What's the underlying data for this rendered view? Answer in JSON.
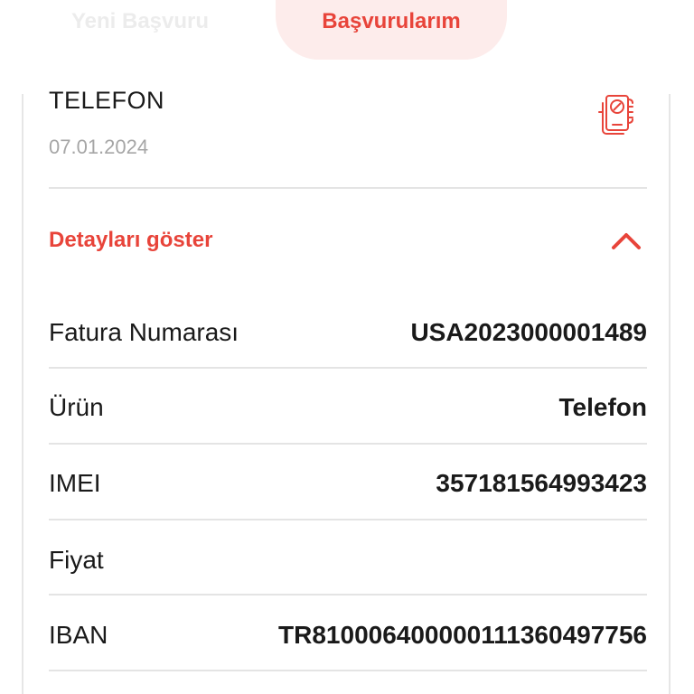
{
  "tabs": {
    "new_label": "Yeni Başvuru",
    "mine_label": "Başvurularım"
  },
  "application": {
    "title": "TELEFON",
    "date": "07.01.2024",
    "icon": "phone-check-icon"
  },
  "details": {
    "toggle_label": "Detayları göster",
    "rows": [
      {
        "label": "Fatura Numarası",
        "value": "USA2023000001489"
      },
      {
        "label": "Ürün",
        "value": "Telefon"
      },
      {
        "label": "IMEI",
        "value": "357181564993423"
      },
      {
        "label": "Fiyat",
        "value": ""
      },
      {
        "label": "IBAN",
        "value": "TR810006400000111360497756"
      }
    ]
  },
  "colors": {
    "accent": "#e8443a",
    "accent_soft": "#fdeceb",
    "muted": "#a6a6a6",
    "divider": "#e4e4e4"
  }
}
